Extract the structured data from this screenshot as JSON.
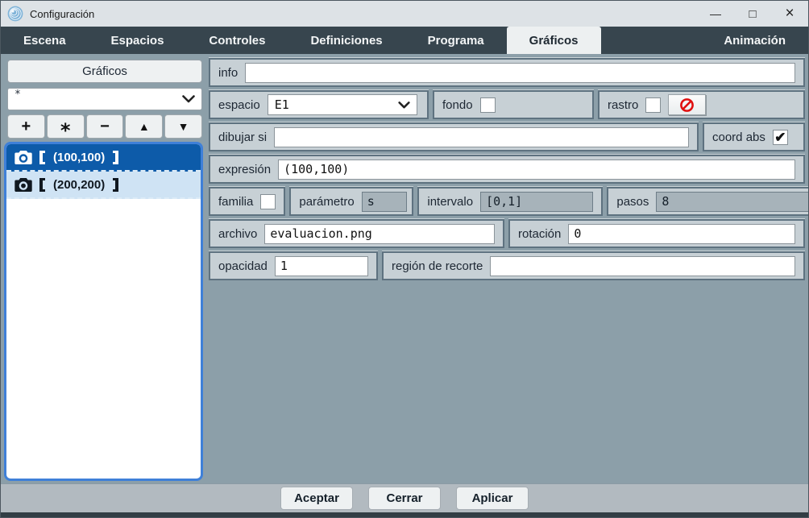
{
  "window": {
    "title": "Configuración",
    "controls": {
      "minimize": "—",
      "maximize": "□",
      "close": "×"
    }
  },
  "tabs": [
    {
      "label": "Escena",
      "selected": false
    },
    {
      "label": "Espacios",
      "selected": false
    },
    {
      "label": "Controles",
      "selected": false
    },
    {
      "label": "Definiciones",
      "selected": false
    },
    {
      "label": "Programa",
      "selected": false
    },
    {
      "label": "Gráficos",
      "selected": true
    },
    {
      "label": "Animación",
      "selected": false
    }
  ],
  "sidebar": {
    "header": "Gráficos",
    "filter_value": "*",
    "toolbar": [
      {
        "name": "add",
        "glyph": "+"
      },
      {
        "name": "duplicate",
        "glyph": "*"
      },
      {
        "name": "remove",
        "glyph": "−"
      },
      {
        "name": "move-up",
        "glyph": "▲"
      },
      {
        "name": "move-down",
        "glyph": "▼"
      }
    ],
    "items": [
      {
        "label": "【(100,100)】",
        "expr": "(100,100)",
        "icon": "camera-icon",
        "selected": true
      },
      {
        "label": "【(200,200)】",
        "expr": "(200,200)",
        "icon": "camera-icon",
        "selected": false
      }
    ]
  },
  "form": {
    "info": {
      "label": "info",
      "value": ""
    },
    "espacio": {
      "label": "espacio",
      "value": "E1"
    },
    "fondo": {
      "label": "fondo",
      "checked": false
    },
    "rastro": {
      "label": "rastro",
      "checked": false,
      "clear_icon": "no-entry-icon"
    },
    "dibujar_si": {
      "label": "dibujar si",
      "value": ""
    },
    "coord_abs": {
      "label": "coord abs",
      "checked": true,
      "glyph": "✔"
    },
    "expresion": {
      "label": "expresión",
      "value": "(100,100)"
    },
    "familia": {
      "label": "familia",
      "checked": false
    },
    "parametro": {
      "label": "parámetro",
      "value": "s",
      "disabled": true
    },
    "intervalo": {
      "label": "intervalo",
      "value": "[0,1]",
      "disabled": true
    },
    "pasos": {
      "label": "pasos",
      "value": "8",
      "disabled": true
    },
    "archivo": {
      "label": "archivo",
      "value": "evaluacion.png"
    },
    "rotacion": {
      "label": "rotación",
      "value": "0"
    },
    "opacidad": {
      "label": "opacidad",
      "value": "1"
    },
    "region": {
      "label": "región de recorte",
      "value": ""
    }
  },
  "footer": {
    "buttons": [
      {
        "label": "Aceptar"
      },
      {
        "label": "Cerrar"
      },
      {
        "label": "Aplicar"
      }
    ]
  },
  "colors": {
    "tabbar_bg": "#37454e",
    "panel_bg": "#8c9fa9",
    "group_bg": "#c7d0d5",
    "list_border_blue": "#3f80d8",
    "selected_item_bg": "#0d5ba9",
    "alt_item_bg": "#cfe3f4",
    "prohibit_red": "#e01010"
  }
}
